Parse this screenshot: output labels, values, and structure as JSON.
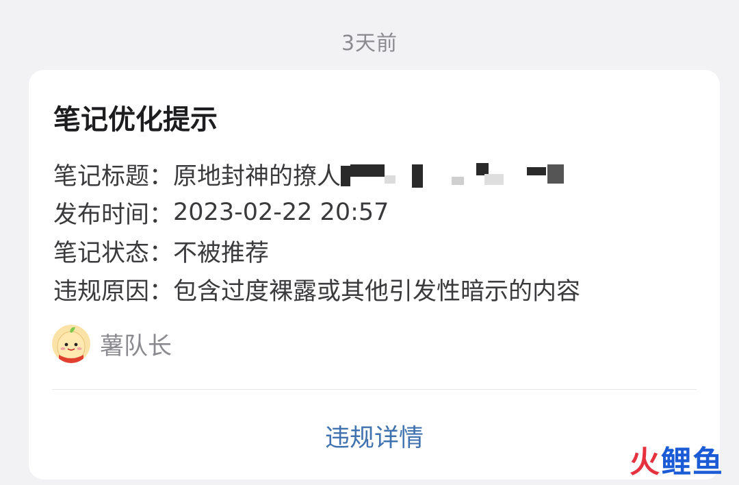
{
  "timestamp": "3天前",
  "card": {
    "title": "笔记优化提示",
    "rows": [
      {
        "label": "笔记标题：",
        "value": "原地封神的撩人"
      },
      {
        "label": "发布时间：",
        "value": "2023-02-22 20:57"
      },
      {
        "label": "笔记状态：",
        "value": "不被推荐"
      },
      {
        "label": "违规原因：",
        "value": "包含过度裸露或其他引发性暗示的内容"
      }
    ],
    "sender": {
      "name": "薯队长",
      "avatar_icon": "cartoon-potato-avatar"
    },
    "action_label": "违规详情",
    "colors": {
      "link": "#3f72af",
      "background": "#f2f2f4",
      "card": "#ffffff"
    }
  },
  "watermark": {
    "fire": "火",
    "rest": "鲤鱼"
  }
}
